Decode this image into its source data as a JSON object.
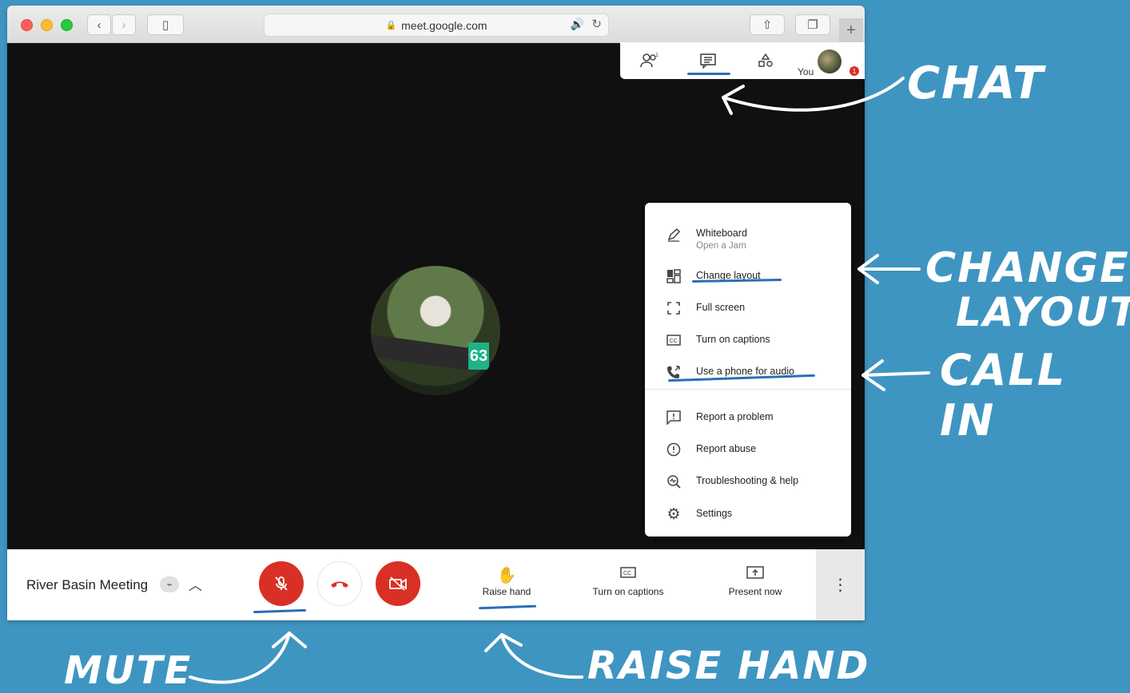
{
  "browser": {
    "url": "meet.google.com"
  },
  "top_panel": {
    "you_label": "You",
    "badge_count": "1"
  },
  "menu": {
    "items": [
      {
        "label": "Whiteboard",
        "sub": "Open a Jam",
        "icon": "pencil-icon"
      },
      {
        "label": "Change layout",
        "icon": "layout-icon"
      },
      {
        "label": "Full screen",
        "icon": "fullscreen-icon"
      },
      {
        "label": "Turn on captions",
        "icon": "captions-icon"
      },
      {
        "label": "Use a phone for audio",
        "icon": "phone-icon"
      },
      {
        "label": "Report a problem",
        "icon": "report-problem-icon"
      },
      {
        "label": "Report abuse",
        "icon": "report-abuse-icon"
      },
      {
        "label": "Troubleshooting & help",
        "icon": "troubleshoot-icon"
      },
      {
        "label": "Settings",
        "icon": "settings-icon"
      }
    ]
  },
  "participant": {
    "bib_number": "63"
  },
  "bottom_bar": {
    "meeting_title": "River Basin Meeting",
    "raise_hand": "Raise hand",
    "captions": "Turn on captions",
    "present": "Present now"
  },
  "annotations": {
    "chat": "CHAT",
    "change_layout_line1": "CHANGE",
    "change_layout_line2": "LAYOUT",
    "call_in": "CALL IN",
    "mute": "MUTE",
    "raise_hand": "RAISE HAND"
  },
  "colors": {
    "background": "#3f95c1",
    "mute_red": "#d93025",
    "accent_blue": "#2a6fb8"
  }
}
